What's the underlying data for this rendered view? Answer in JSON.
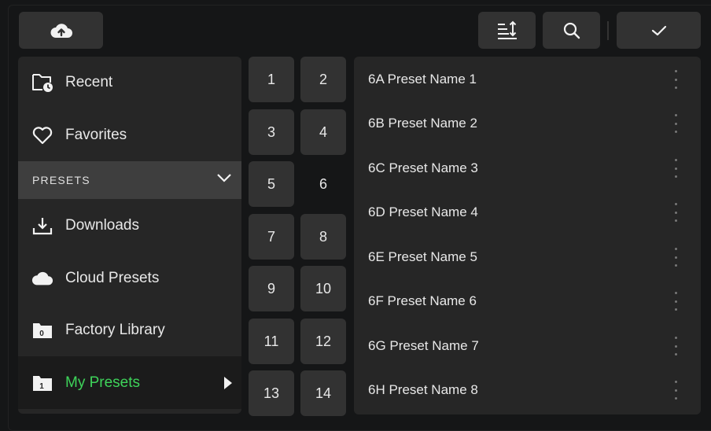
{
  "toolbar": {
    "upload_icon": "cloud-upload-icon",
    "sort_icon": "sort-icon",
    "search_icon": "search-icon",
    "confirm_icon": "check-icon"
  },
  "sidebar": {
    "items": [
      {
        "label": "Recent",
        "icon": "folder-clock-icon"
      },
      {
        "label": "Favorites",
        "icon": "heart-icon"
      }
    ],
    "section": {
      "label": "PRESETS",
      "icon": "chevron-down-icon"
    },
    "section_items": [
      {
        "label": "Downloads",
        "icon": "download-icon"
      },
      {
        "label": "Cloud Presets",
        "icon": "cloud-icon"
      },
      {
        "label": "Factory Library",
        "icon": "folder-icon",
        "badge": "0"
      },
      {
        "label": "My Presets",
        "icon": "folder-icon",
        "badge": "1",
        "active": true
      }
    ],
    "active_color": "#3ed35a"
  },
  "banks": [
    "1",
    "2",
    "3",
    "4",
    "5",
    "6",
    "7",
    "8",
    "9",
    "10",
    "11",
    "12",
    "13",
    "14"
  ],
  "selected_bank": "6",
  "presets": [
    "6A Preset Name 1",
    "6B Preset Name 2",
    "6C Preset Name 3",
    "6D Preset Name 4",
    "6E Preset Name 5",
    "6F Preset Name 6",
    "6G Preset Name 7",
    "6H Preset Name 8"
  ]
}
